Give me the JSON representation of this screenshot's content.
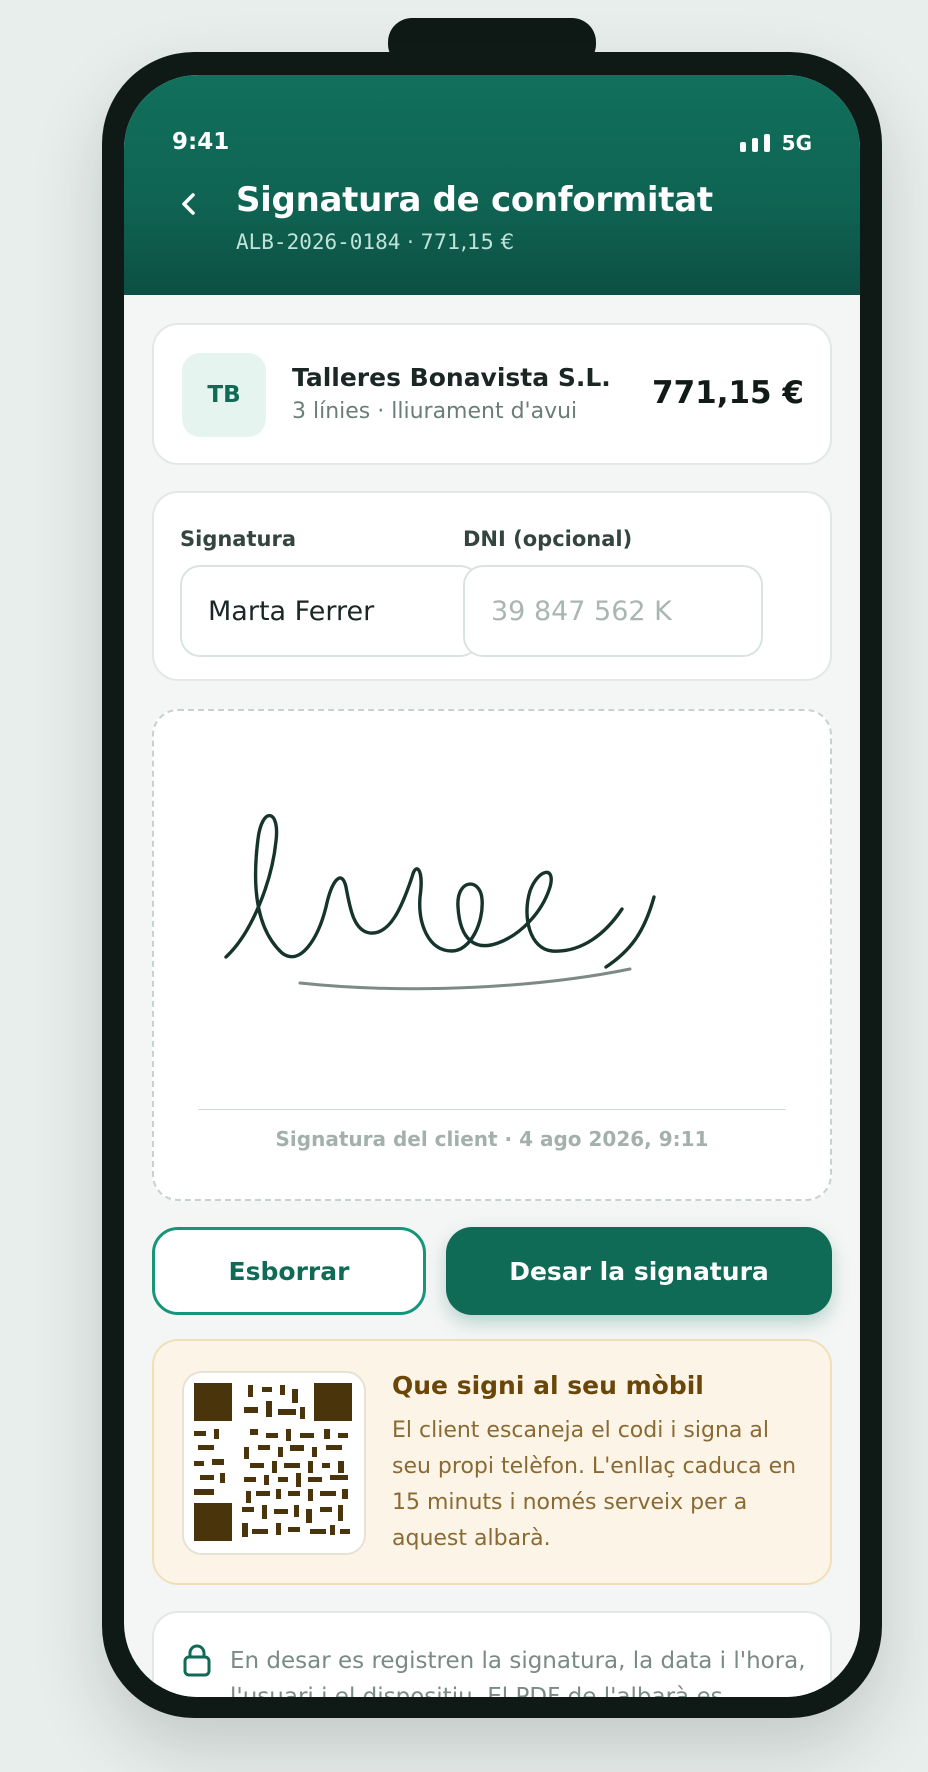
{
  "status_bar": {
    "time": "9:41",
    "network": "5G"
  },
  "header": {
    "title": "Signatura de conformitat",
    "doc_ref": "ALB-2026-0184",
    "amount": "· 771,15 €"
  },
  "client": {
    "initials": "TB",
    "name": "Talleres Bonavista S.L.",
    "details": "3 línies · lliurament d'avui",
    "total": "771,15 €"
  },
  "form": {
    "signature_label": "Signatura",
    "signature_value": "Marta Ferrer",
    "dni_label": "DNI (opcional)",
    "dni_placeholder": "39 847 562 K"
  },
  "signature_pad": {
    "caption": "Signatura del client · 4 ago 2026, 9:11"
  },
  "actions": {
    "clear_label": "Esborrar",
    "save_label": "Desar la signatura"
  },
  "qr_section": {
    "title": "Que signi al seu mòbil",
    "description": "El client escaneja el codi i signa al seu propi telèfon. L'enllaç caduca en 15 minuts i només serveix per a aquest albarà."
  },
  "info": {
    "text": "En desar es registren la signatura, la data i l'hora, l'usuari i el dispositiu. El PDF de l'albarà es"
  },
  "colors": {
    "primary": "#0f6a56",
    "accent_border": "#17957a",
    "qr_background": "#fcf5e7",
    "qr_title": "#6a4609"
  },
  "icons": [
    "chevron-left-icon",
    "signal-icon",
    "qr-code-icon",
    "lock-icon"
  ]
}
